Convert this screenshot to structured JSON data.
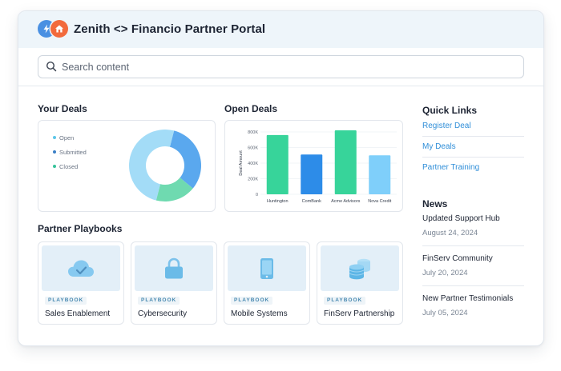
{
  "app": {
    "title": "Zenith <> Financio Partner Portal",
    "brand_colors": {
      "zenith": "#4a90e2",
      "financio": "#f26a3d",
      "header_bg": "#eef5fa"
    }
  },
  "search": {
    "placeholder": "Search content",
    "value": ""
  },
  "your_deals": {
    "title": "Your Deals",
    "chart_data": {
      "type": "pie",
      "series": [
        {
          "name": "Open",
          "value": 50,
          "color": "#a3dcf7"
        },
        {
          "name": "Submitted",
          "value": 32,
          "color": "#5aa8ee"
        },
        {
          "name": "Closed",
          "value": 18,
          "color": "#6fdab0"
        }
      ],
      "legend_colors": {
        "Open": "#5cc6e8",
        "Submitted": "#3b7fc6",
        "Closed": "#35c29a"
      }
    }
  },
  "open_deals": {
    "title": "Open Deals",
    "chart_data": {
      "type": "bar",
      "categories": [
        "Huntington",
        "ComBank",
        "Acme Advisors",
        "Nova Credit"
      ],
      "values": [
        760,
        510,
        820,
        500
      ],
      "colors": [
        "#37d49a",
        "#2d8ce8",
        "#37d49a",
        "#7fcffa"
      ],
      "ylabel": "Deal Amount",
      "yticks": [
        "0",
        "200K",
        "400K",
        "600K",
        "800K"
      ],
      "ylim": [
        0,
        800
      ],
      "grid": true
    }
  },
  "playbooks": {
    "title": "Partner Playbooks",
    "badge": "PLAYBOOK",
    "items": [
      {
        "label": "Sales Enablement",
        "icon": "cloud-check-icon"
      },
      {
        "label": "Cybersecurity",
        "icon": "lock-icon"
      },
      {
        "label": "Mobile Systems",
        "icon": "phone-icon"
      },
      {
        "label": "FinServ Partnership",
        "icon": "coins-icon"
      }
    ]
  },
  "quick_links": {
    "title": "Quick Links",
    "items": [
      "Register Deal",
      "My Deals",
      "Partner Training"
    ]
  },
  "news": {
    "title": "News",
    "items": [
      {
        "title": "Updated Support Hub",
        "date": "August 24, 2024"
      },
      {
        "title": "FinServ Community",
        "date": "July 20, 2024"
      },
      {
        "title": "New Partner Testimonials",
        "date": "July 05, 2024"
      }
    ]
  }
}
